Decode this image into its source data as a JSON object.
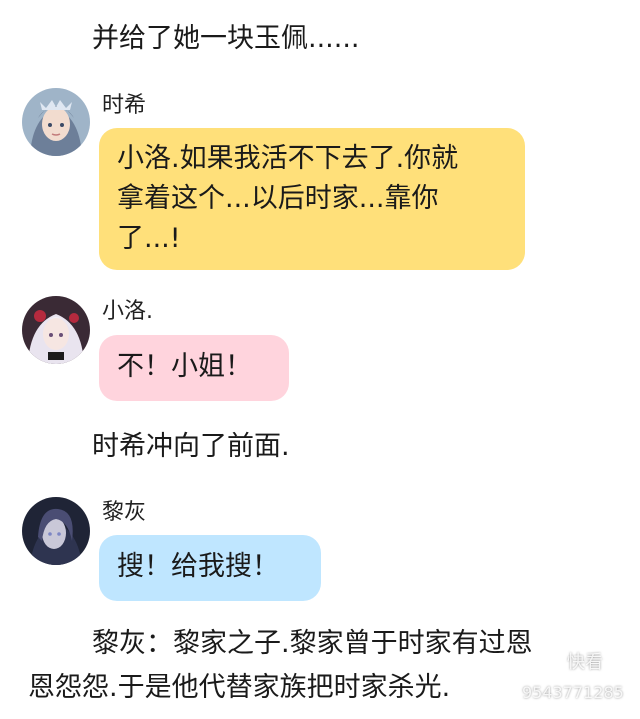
{
  "narration": {
    "line1": "并给了她一块玉佩......",
    "line2": "时希冲向了前面.",
    "line3a": "黎灰：黎家之子.黎家曾于时家有过恩",
    "line3b": "恩怨怨.于是他代替家族把时家杀光."
  },
  "messages": [
    {
      "sender": "时希",
      "avatar_icon": "character-avatar-shixi",
      "bubble_color": "#ffe07a",
      "lines": [
        "小洛.如果我活不下去了.你就",
        "拿着这个...以后时家...靠你",
        "了...!"
      ]
    },
    {
      "sender": "小洛.",
      "avatar_icon": "character-avatar-xiaoluo",
      "bubble_color": "#ffd4dd",
      "lines": [
        "不！小姐！"
      ]
    },
    {
      "sender": "黎灰",
      "avatar_icon": "character-avatar-lihui",
      "bubble_color": "#bfe6ff",
      "lines": [
        "搜！给我搜！"
      ]
    }
  ],
  "watermark": {
    "logo_text": "快看",
    "id_text": "9543771285"
  }
}
